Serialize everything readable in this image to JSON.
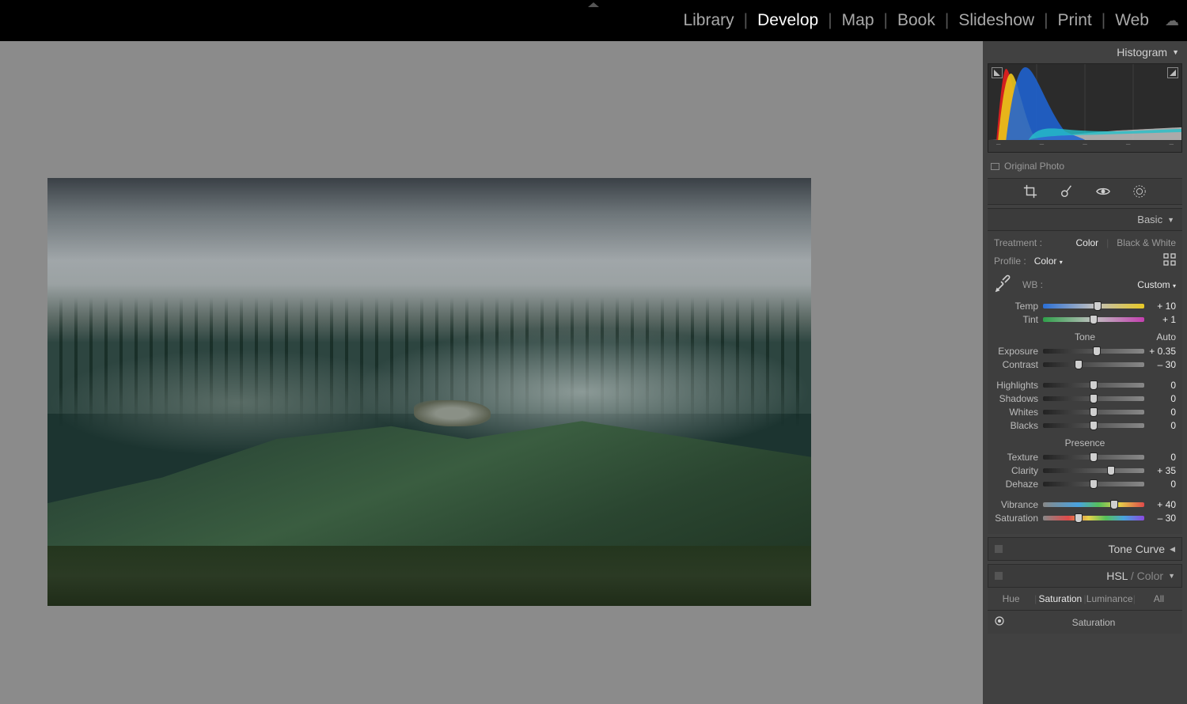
{
  "modules": {
    "items": [
      "Library",
      "Develop",
      "Map",
      "Book",
      "Slideshow",
      "Print",
      "Web"
    ],
    "active": "Develop"
  },
  "right": {
    "histogram_label": "Histogram",
    "original_photo_label": "Original Photo",
    "basic_label": "Basic",
    "treatment_label": "Treatment :",
    "treatment_color": "Color",
    "treatment_bw": "Black & White",
    "profile_label": "Profile :",
    "profile_value": "Color",
    "wb_label": "WB :",
    "wb_value": "Custom",
    "tone_label": "Tone",
    "auto_label": "Auto",
    "presence_label": "Presence",
    "tone_curve_label": "Tone Curve",
    "hsl_label_hsl": "HSL",
    "hsl_label_color": "Color",
    "hsl_tabs": {
      "hue": "Hue",
      "sat": "Saturation",
      "lum": "Luminance",
      "all": "All"
    },
    "hsl_sub": "Saturation",
    "sliders": {
      "temp": {
        "label": "Temp",
        "value": "+ 10",
        "pos": 54
      },
      "tint": {
        "label": "Tint",
        "value": "+ 1",
        "pos": 50
      },
      "exposure": {
        "label": "Exposure",
        "value": "+ 0.35",
        "pos": 53
      },
      "contrast": {
        "label": "Contrast",
        "value": "– 30",
        "pos": 35
      },
      "highlights": {
        "label": "Highlights",
        "value": "0",
        "pos": 50
      },
      "shadows": {
        "label": "Shadows",
        "value": "0",
        "pos": 50
      },
      "whites": {
        "label": "Whites",
        "value": "0",
        "pos": 50
      },
      "blacks": {
        "label": "Blacks",
        "value": "0",
        "pos": 50
      },
      "texture": {
        "label": "Texture",
        "value": "0",
        "pos": 50
      },
      "clarity": {
        "label": "Clarity",
        "value": "+ 35",
        "pos": 67
      },
      "dehaze": {
        "label": "Dehaze",
        "value": "0",
        "pos": 50
      },
      "vibrance": {
        "label": "Vibrance",
        "value": "+ 40",
        "pos": 70
      },
      "saturation": {
        "label": "Saturation",
        "value": "– 30",
        "pos": 35
      }
    }
  }
}
